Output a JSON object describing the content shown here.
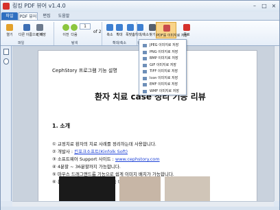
{
  "window": {
    "title": "링킹 PDF 뷰어 v1.4.0",
    "minimize": "–",
    "maximize": "□",
    "close": "×"
  },
  "tabs": [
    {
      "label": "파일"
    },
    {
      "label": "PDF 뷰어"
    },
    {
      "label": "편집"
    },
    {
      "label": "도움말"
    }
  ],
  "ribbon": {
    "buttons": [
      {
        "label": "열기",
        "icon": "folder-icon",
        "color": "#e3a12b"
      },
      {
        "label": "다른 이름으로 저장",
        "icon": "save-icon",
        "color": "#3d6fb5"
      },
      {
        "label": "인쇄",
        "icon": "print-icon",
        "color": "#6c7a8d"
      },
      {
        "label": "이전",
        "icon": "prev-icon",
        "color": "#8cc63e"
      },
      {
        "label": "다음",
        "icon": "next-icon",
        "color": "#8cc63e"
      },
      {
        "label": "축소",
        "icon": "zoom-out-icon",
        "color": "#3d7fd1"
      },
      {
        "label": "확대",
        "icon": "zoom-in-icon",
        "color": "#3d7fd1"
      },
      {
        "label": "폭맞춤",
        "icon": "fit-width-icon",
        "color": "#3d7fd1"
      },
      {
        "label": "확대/축소",
        "icon": "zoom-icon",
        "color": "#3d7fd1"
      },
      {
        "label": "찾기",
        "icon": "find-icon",
        "color": "#555f6d"
      },
      {
        "label": "PDF를 이미지로 저장",
        "icon": "pdf-to-image-icon",
        "color": "#c94b4b"
      },
      {
        "label": "종료",
        "icon": "exit-icon",
        "color": "#d6312b"
      }
    ],
    "page_current": "1",
    "page_total": "of 2",
    "groups": [
      {
        "label": "파일"
      },
      {
        "label": "탐색"
      },
      {
        "label": "확대/축소"
      },
      {
        "label": "검색"
      }
    ]
  },
  "menu": {
    "items": [
      {
        "label": "JPEG 이미지로 저장"
      },
      {
        "label": "PNG 이미지로 저장"
      },
      {
        "label": "BMP 이미지로 저장"
      },
      {
        "label": "GIF 이미지로 저장"
      },
      {
        "label": "TIFF 이미지로 저장"
      },
      {
        "label": "Icon 이미지로 저장"
      },
      {
        "label": "EMF 이미지로 저장"
      },
      {
        "label": "WMF 이미지로 저장"
      }
    ]
  },
  "document": {
    "header": "CephStory 프로그램 기능 설명",
    "title": "환자 치료 case 정리 기능 리뷰",
    "section": "1. 소개",
    "bullets": [
      {
        "num": "①",
        "text": "교정치료 환자의 치료 사례를 정리하는데 사용합니다."
      },
      {
        "num": "②",
        "text": "개발사 : ",
        "link": "킨포크소프트(Kinfolk Soft)"
      },
      {
        "num": "③",
        "text": "소프트웨어 Support 사이트 : ",
        "link": "www.cephstory.com"
      },
      {
        "num": "④",
        "text": "4분할 ~ 36분할까지 가능합니다."
      },
      {
        "num": "⑤",
        "text": "마우스 드래그앤드롭 기능으로 쉽게 이미지 배치가 가능합니다."
      },
      {
        "num": "⑥",
        "text": "분할 격자내 최적의 위치로 자동 배치됩니다."
      }
    ],
    "link_color": "#1a3fd6"
  }
}
